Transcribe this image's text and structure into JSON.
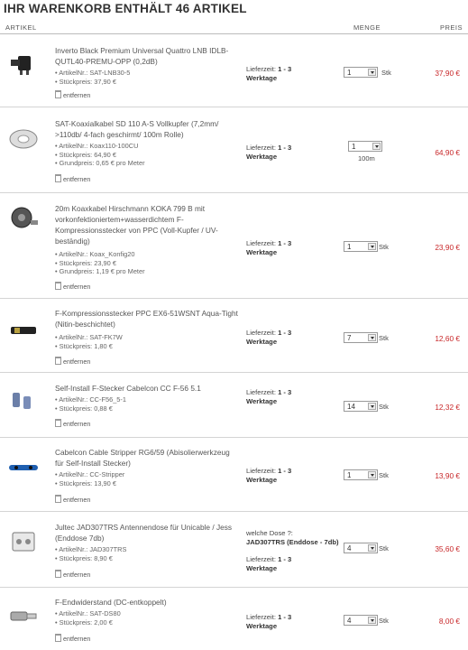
{
  "cart": {
    "title": "IHR WARENKORB ENTHÄLT 46 ARTIKEL",
    "col_article": "ARTIKEL",
    "col_qty": "MENGE",
    "col_price": "PREIS",
    "remove_label": "entfernen"
  },
  "items": [
    {
      "name": "Inverto Black Premium Universal Quattro LNB IDLB-QUTL40-PREMU-OPP (0,2dB)",
      "details": [
        "ArtikelNr.: SAT-LNB30-5",
        "Stückpreis: 37,90 €"
      ],
      "delivery_label": "Lieferzeit:",
      "delivery_value": "1 - 3",
      "delivery_unit": "Werktage",
      "qty": "1",
      "unit": "Stk",
      "price": "37,90 €"
    },
    {
      "name": "SAT-Koaxialkabel SD 110 A-S Vollkupfer (7,2mm/ >110db/ 4-fach geschirmt/ 100m Rolle)",
      "details": [
        "ArtikelNr.: Koax110-100CU",
        "Stückpreis: 64,90 €",
        "Grundpreis: 0,65 € pro Meter"
      ],
      "delivery_label": "Lieferzeit:",
      "delivery_value": "1 - 3",
      "delivery_unit": "Werktage",
      "qty": "1",
      "unit": "100m",
      "price": "64,90 €"
    },
    {
      "name": "20m Koaxkabel Hirschmann KOKA 799 B mit vorkonfektioniertem+wasserdichtem F-Kompressionsstecker von PPC (Voll-Kupfer / UV-beständig)",
      "details": [
        "ArtikelNr.: Koax_Konfig20",
        "Stückpreis: 23,90 €",
        "Grundpreis: 1,19 € pro Meter"
      ],
      "delivery_label": "Lieferzeit:",
      "delivery_value": "1 - 3",
      "delivery_unit": "Werktage",
      "qty": "1",
      "unit": "Stk",
      "price": "23,90 €"
    },
    {
      "name": "F-Kompressionsstecker PPC EX6-51WSNT Aqua-Tight (Nitin-beschichtet)",
      "details": [
        "ArtikelNr.: SAT-FK7W",
        "Stückpreis: 1,80 €"
      ],
      "delivery_label": "Lieferzeit:",
      "delivery_value": "1 - 3",
      "delivery_unit": "Werktage",
      "qty": "7",
      "unit": "Stk",
      "price": "12,60 €"
    },
    {
      "name": "Self-Install F-Stecker Cabelcon CC F-56 5.1",
      "details": [
        "ArtikelNr.: CC-F56_5-1",
        "Stückpreis: 0,88 €"
      ],
      "delivery_label": "Lieferzeit:",
      "delivery_value": "1 - 3",
      "delivery_unit": "Werktage",
      "qty": "14",
      "unit": "Stk",
      "price": "12,32 €"
    },
    {
      "name": "Cabelcon Cable Stripper RG6/59 (Abisolierwerkzeug für Self-Install Stecker)",
      "details": [
        "ArtikelNr.: CC-Stripper",
        "Stückpreis: 13,90 €"
      ],
      "delivery_label": "Lieferzeit:",
      "delivery_value": "1 - 3",
      "delivery_unit": "Werktage",
      "qty": "1",
      "unit": "Stk",
      "price": "13,90 €"
    },
    {
      "name": "Jultec JAD307TRS Antennendose für Unicable / Jess (Enddose 7db)",
      "details": [
        "ArtikelNr.: JAD307TRS",
        "Stückpreis: 8,90 €"
      ],
      "option_label": "welche Dose ?:",
      "option_value": "JAD307TRS (Enddose - 7db)",
      "delivery_label": "Lieferzeit:",
      "delivery_value": "1 - 3",
      "delivery_unit": "Werktage",
      "qty": "4",
      "unit": "Stk",
      "price": "35,60 €"
    },
    {
      "name": "F-Endwiderstand (DC-entkoppelt)",
      "details": [
        "ArtikelNr.: SAT-DS80",
        "Stückpreis: 2,00 €"
      ],
      "delivery_label": "Lieferzeit:",
      "delivery_value": "1 - 3",
      "delivery_unit": "Werktage",
      "qty": "4",
      "unit": "Stk",
      "price": "8,00 €"
    }
  ]
}
